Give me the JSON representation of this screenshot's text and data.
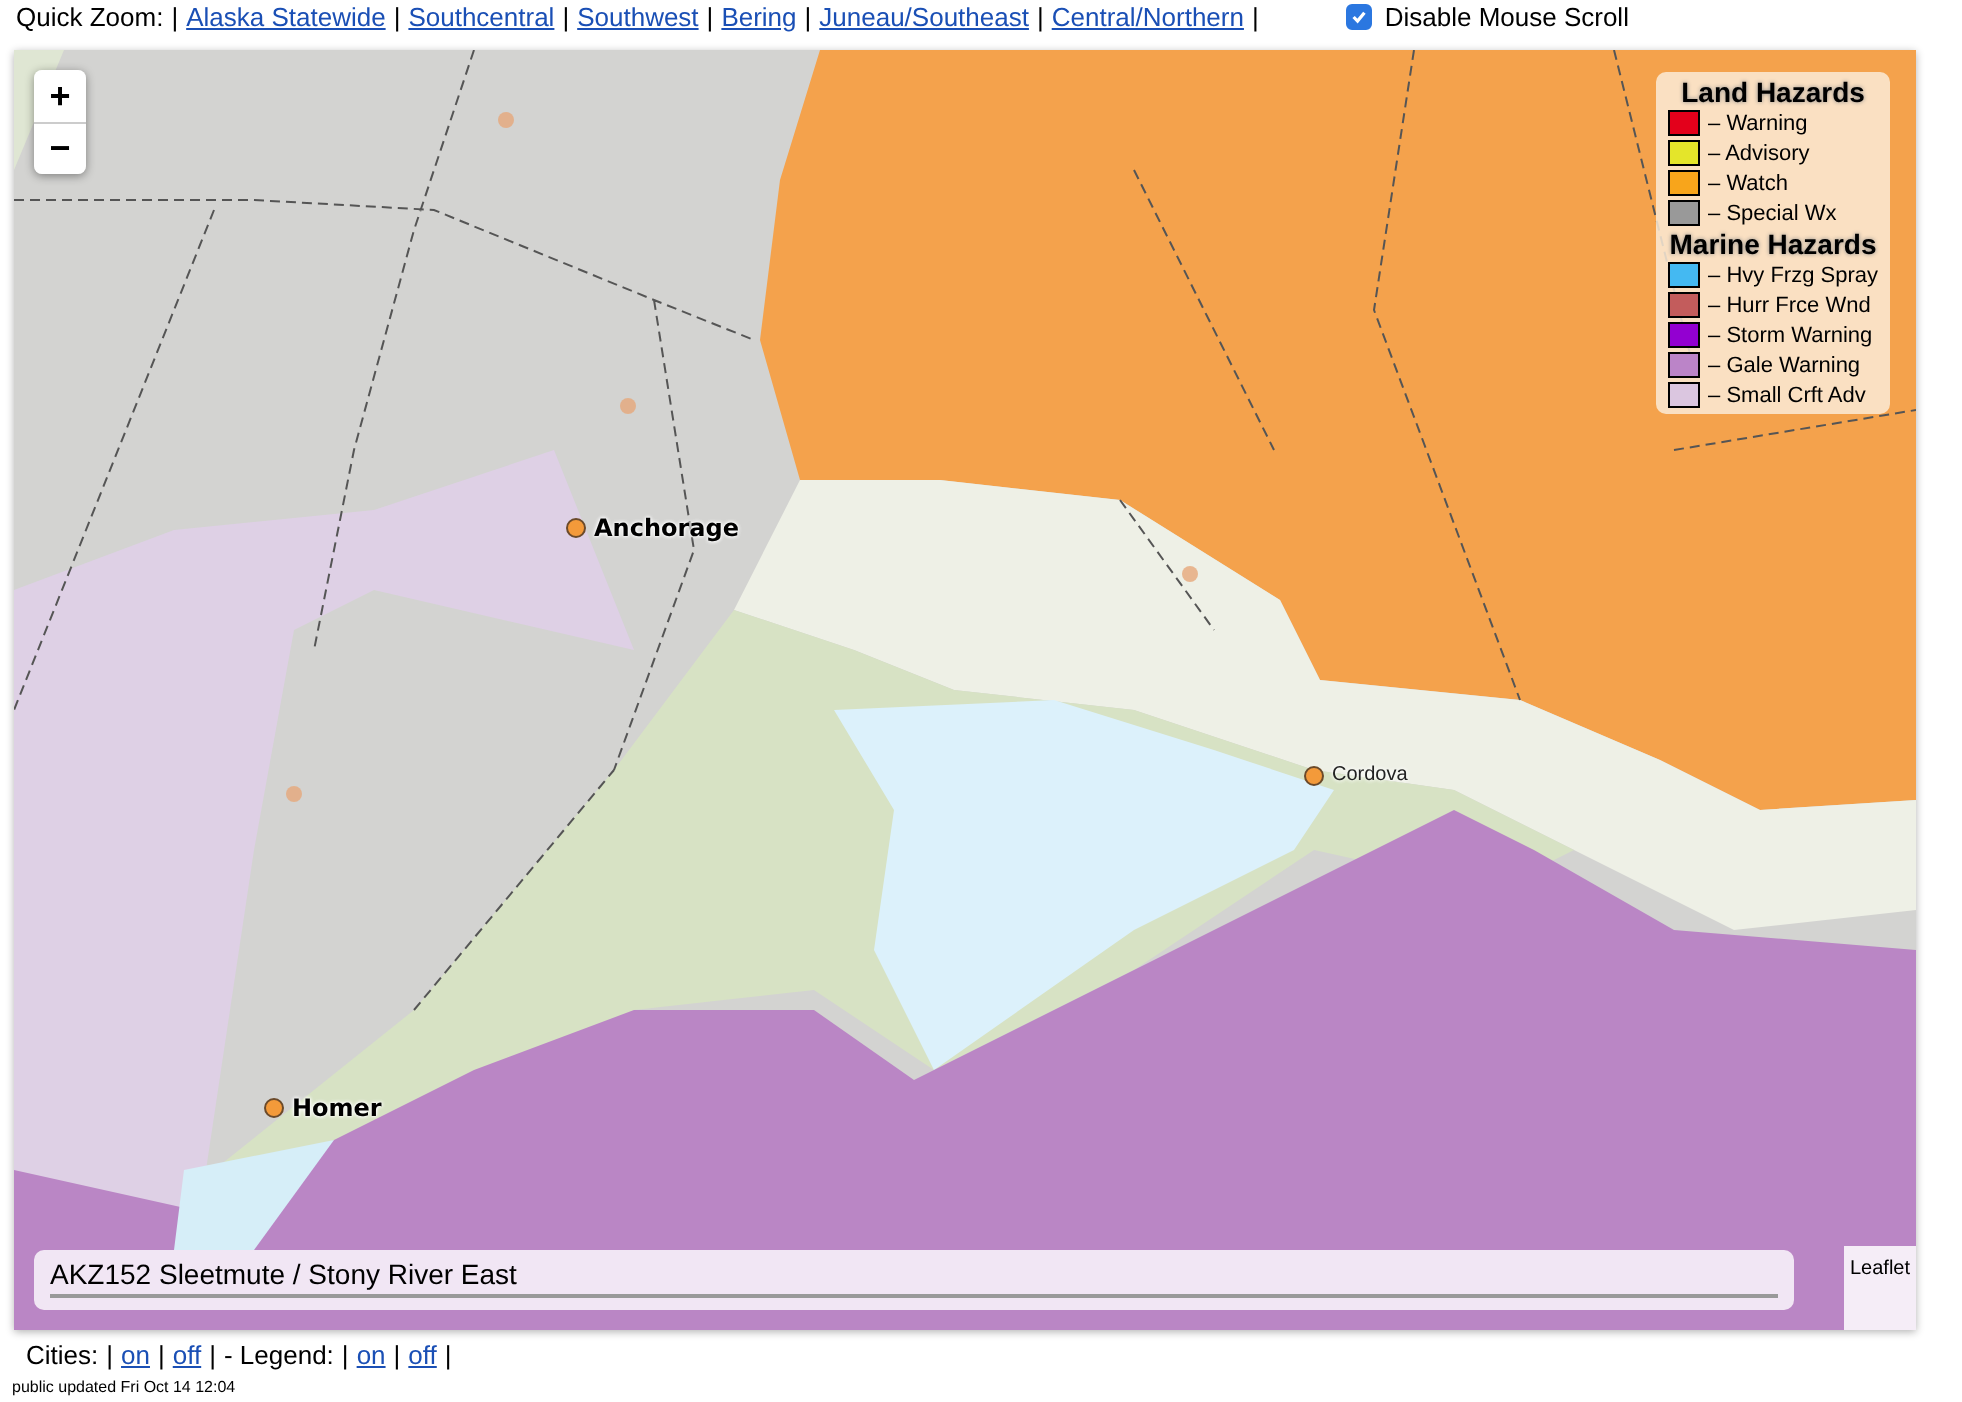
{
  "quick_zoom": {
    "label": "Quick Zoom:",
    "separator": "|",
    "links": [
      "Alaska Statewide",
      "Southcentral",
      "Southwest",
      "Bering",
      "Juneau/Southeast",
      "Central/Northern"
    ]
  },
  "disable_mouse_scroll": {
    "label": "Disable Mouse Scroll",
    "checked": true
  },
  "map": {
    "zoom_in": "+",
    "zoom_out": "−",
    "cities": [
      {
        "name": "Anchorage",
        "kind": "major"
      },
      {
        "name": "Homer",
        "kind": "major"
      },
      {
        "name": "Cordova",
        "kind": "minor"
      }
    ],
    "legend": [
      {
        "title": "Land Hazards",
        "items": [
          {
            "label": "– Warning",
            "color": "#e3001b"
          },
          {
            "label": "– Advisory",
            "color": "#e4e52a"
          },
          {
            "label": "– Watch",
            "color": "#f8a51b"
          },
          {
            "label": "– Special Wx",
            "color": "#999999"
          }
        ]
      },
      {
        "title": "Marine Hazards",
        "items": [
          {
            "label": "– Hvy Frzg Spray",
            "color": "#44b9f2"
          },
          {
            "label": "– Hurr Frce Wnd",
            "color": "#c35c5c"
          },
          {
            "label": "– Storm Warning",
            "color": "#9300d1"
          },
          {
            "label": "– Gale Warning",
            "color": "#bb84c8"
          },
          {
            "label": "– Small Crft Adv",
            "color": "#dbc6e0"
          }
        ]
      }
    ],
    "zone_info": "AKZ152 Sleetmute / Stony River East",
    "attribution": "Leaflet"
  },
  "toggles": [
    {
      "label": "Cities:",
      "links": [
        "on",
        "off"
      ]
    },
    {
      "label": "- Legend:",
      "links": [
        "on",
        "off"
      ]
    }
  ],
  "updated": "public updated Fri Oct 14 12:04"
}
